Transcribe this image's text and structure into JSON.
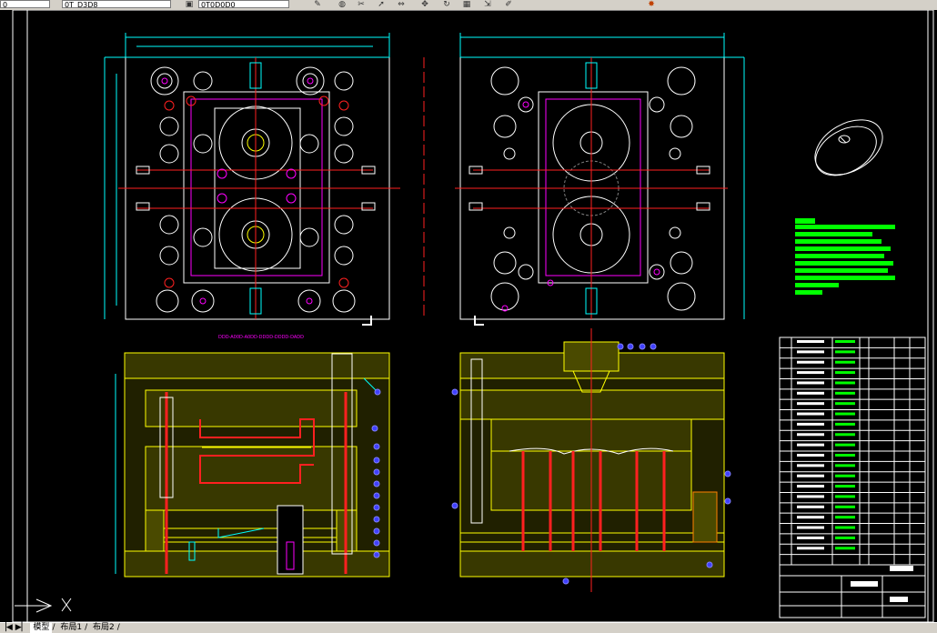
{
  "toolbar": {
    "layer_field": "0",
    "file_field": "0T_D3D8",
    "style_field": "0T0D0D0",
    "icons": [
      "pencil-icon",
      "fill-icon",
      "trim-icon",
      "arrow-icon",
      "mirror-icon",
      "move-icon",
      "rotate-icon",
      "grid-icon",
      "stretch-icon",
      "pen-icon",
      "explode-icon"
    ]
  },
  "drawing": {
    "plan_label_left": "DDD-A00D-A0DD-DDDD-DDDD-DADD",
    "colors": {
      "outline": "#ffffff",
      "center": "#ff2020",
      "cyan": "#00ffff",
      "yellow": "#ffff00",
      "magenta": "#ff00ff",
      "green": "#00ff00",
      "blue": "#4040ff",
      "orange": "#ff8000"
    },
    "notes": [
      "0000000000000",
      "0000000000000000000",
      "000000000000000",
      "0000000000000000000000",
      "00000000000000000000000",
      "000000000000000000000",
      "0000000000000000000000",
      "0000000000",
      "000000"
    ],
    "bom_rows": 22,
    "title_block": {
      "part_name": "0000000",
      "drawing_no": "000000",
      "sheet": "000000"
    }
  },
  "status": {
    "tabs": [
      "模型",
      "布局1",
      "布局2"
    ],
    "active_tab": 0
  }
}
